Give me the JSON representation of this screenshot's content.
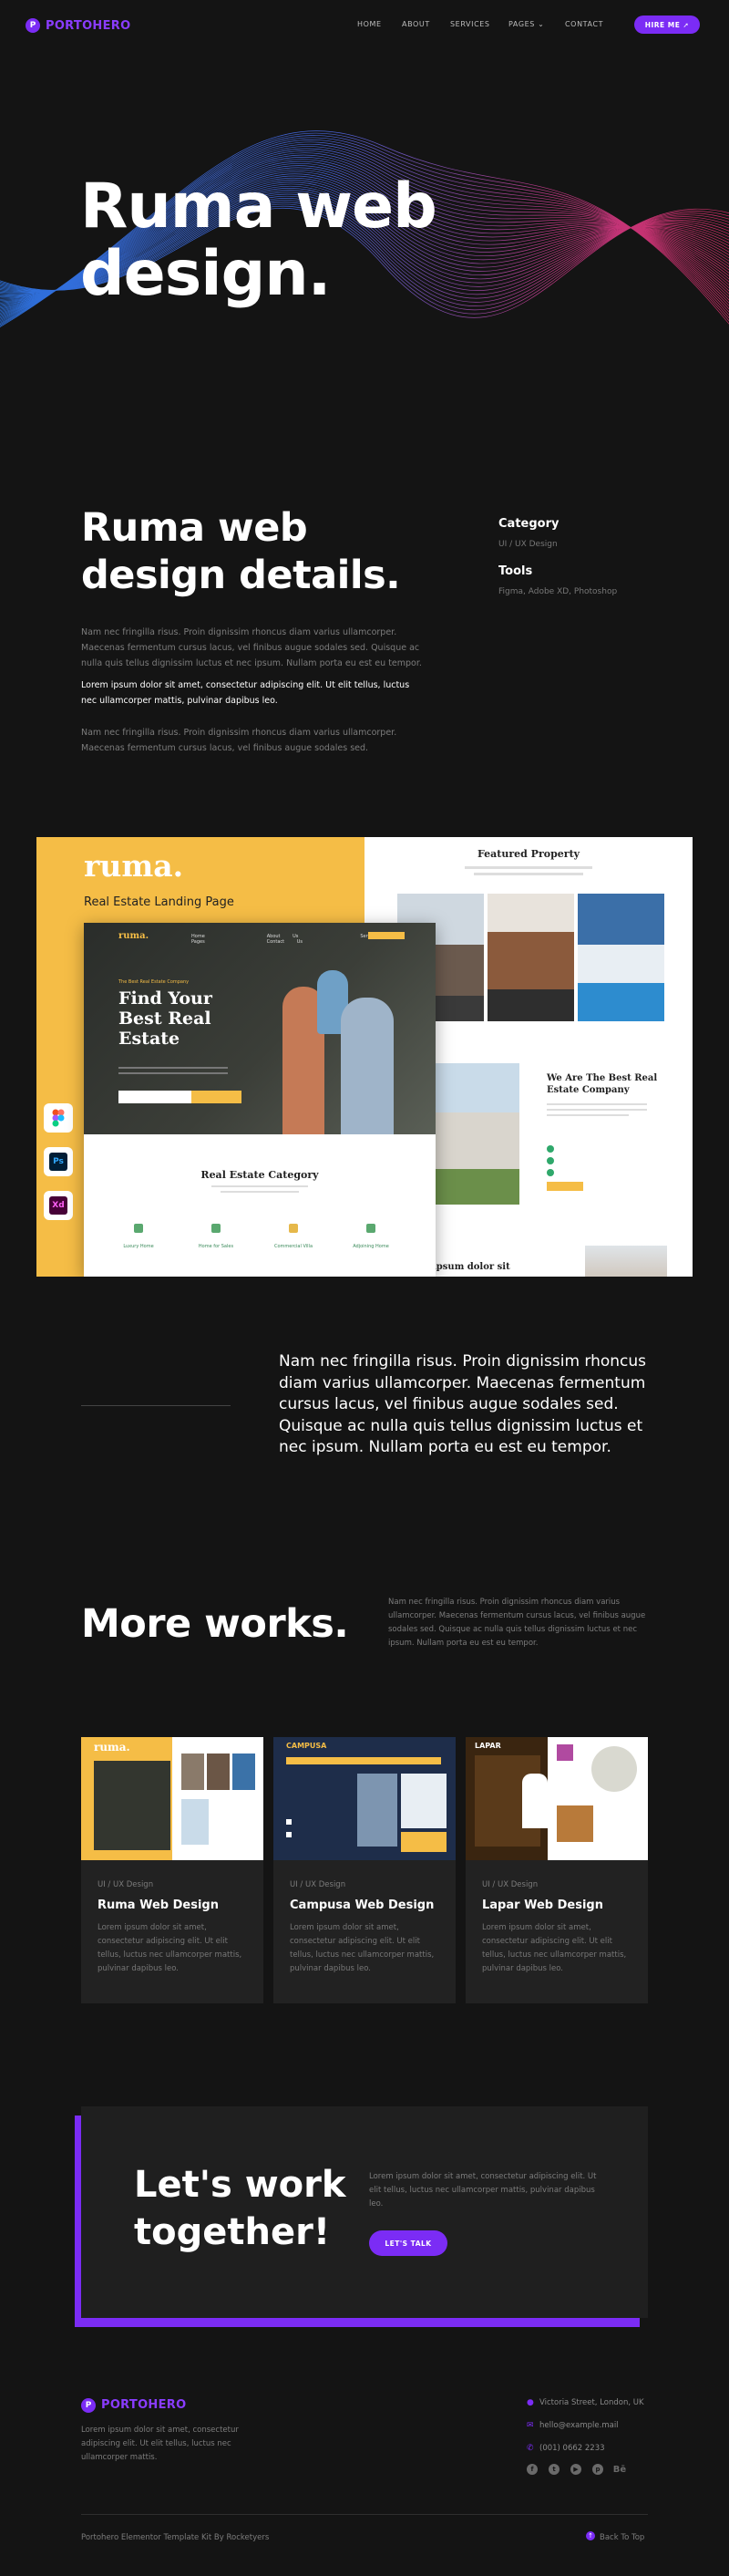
{
  "nav": {
    "logo_letter": "P",
    "logo_text": "PORTOHERO",
    "items": [
      "HOME",
      "ABOUT",
      "SERVICES",
      "PAGES",
      "CONTACT"
    ],
    "hire_label": "HIRE ME"
  },
  "hero": {
    "title_line1": "Ruma web",
    "title_line2": "design."
  },
  "details": {
    "title_line1": "Ruma web",
    "title_line2": "design details.",
    "para1": "Nam nec fringilla risus. Proin dignissim rhoncus diam varius ullamcorper. Maecenas fermentum cursus lacus, vel finibus augue sodales sed. Quisque ac nulla quis tellus dignissim luctus et nec ipsum. Nullam porta eu est eu tempor.",
    "para2": "Lorem ipsum dolor sit amet, consectetur adipiscing elit. Ut elit tellus, luctus nec ullamcorper mattis, pulvinar dapibus leo.",
    "para3": "Nam nec fringilla risus. Proin dignissim rhoncus diam varius ullamcorper. Maecenas fermentum cursus lacus, vel finibus augue sodales sed.",
    "category_label": "Category",
    "category_value": "UI / UX Design",
    "tools_label": "Tools",
    "tools_value": "Figma, Adobe XD, Photoshop"
  },
  "showcase": {
    "brand": "ruma.",
    "subtitle": "Real Estate Landing Page",
    "mock_logo": "ruma.",
    "mock_nav": [
      "Home",
      "About Us",
      "Services",
      "Pages",
      "Contact Us"
    ],
    "mock_hero_kicker": "The Best Real Estate Company",
    "mock_hero_title": "Find Your Best Real Estate",
    "mock_category_title": "Real Estate Category",
    "mock_categories": [
      "Luxury Home",
      "Home for Sales",
      "Commercial Villa",
      "Adjoining Home"
    ],
    "featured_title": "Featured Property",
    "company_title": "We Are The Best Real Estate Company",
    "lorem_cut": "ipsum dolor sit",
    "tool_badges": [
      "Ps",
      "Xd"
    ]
  },
  "quote": "Nam nec fringilla risus. Proin dignissim rhoncus diam varius ullamcorper. Maecenas fermentum cursus lacus, vel finibus augue sodales sed. Quisque ac nulla quis tellus dignissim luctus et nec ipsum. Nullam porta eu est eu tempor.",
  "more": {
    "title": "More works.",
    "para": "Nam nec fringilla risus. Proin dignissim rhoncus diam varius ullamcorper. Maecenas fermentum cursus lacus, vel finibus augue sodales sed. Quisque ac nulla quis tellus dignissim luctus et nec ipsum. Nullam porta eu est eu tempor.",
    "cards": [
      {
        "tag": "UI / UX Design",
        "title": "Ruma Web Design",
        "desc": "Lorem ipsum dolor sit amet, consectetur adipiscing elit. Ut elit tellus, luctus nec ullamcorper mattis, pulvinar dapibus leo.",
        "thumb_brand": "ruma."
      },
      {
        "tag": "UI / UX Design",
        "title": "Campusa Web Design",
        "desc": "Lorem ipsum dolor sit amet, consectetur adipiscing elit. Ut elit tellus, luctus nec ullamcorper mattis, pulvinar dapibus leo.",
        "thumb_brand": "CAMPUSA"
      },
      {
        "tag": "UI / UX Design",
        "title": "Lapar Web Design",
        "desc": "Lorem ipsum dolor sit amet, consectetur adipiscing elit. Ut elit tellus, luctus nec ullamcorper mattis, pulvinar dapibus leo.",
        "thumb_brand": "LAPAR"
      }
    ]
  },
  "cta": {
    "title_line1": "Let's work",
    "title_line2": "together!",
    "para": "Lorem ipsum dolor sit amet, consectetur adipiscing elit. Ut elit tellus, luctus nec ullamcorper mattis, pulvinar dapibus leo.",
    "button": "LET'S TALK"
  },
  "footer": {
    "logo_letter": "P",
    "logo_text": "PORTOHERO",
    "desc": "Lorem ipsum dolor sit amet, consectetur adipiscing elit. Ut elit tellus, luctus nec ullamcorper mattis.",
    "address": "Victoria Street, London, UK",
    "email": "hello@example.mail",
    "phone": "(001) 0662 2233",
    "socials": [
      "facebook-icon",
      "twitter-icon",
      "youtube-icon",
      "pinterest-icon",
      "behance-icon"
    ],
    "copyright": "Portohero Elementor Template Kit By Rocketyers",
    "back_to_top": "Back To Top"
  },
  "colors": {
    "accent": "#7b2cf5",
    "background": "#141414",
    "showcase_yellow": "#f5bd46"
  }
}
